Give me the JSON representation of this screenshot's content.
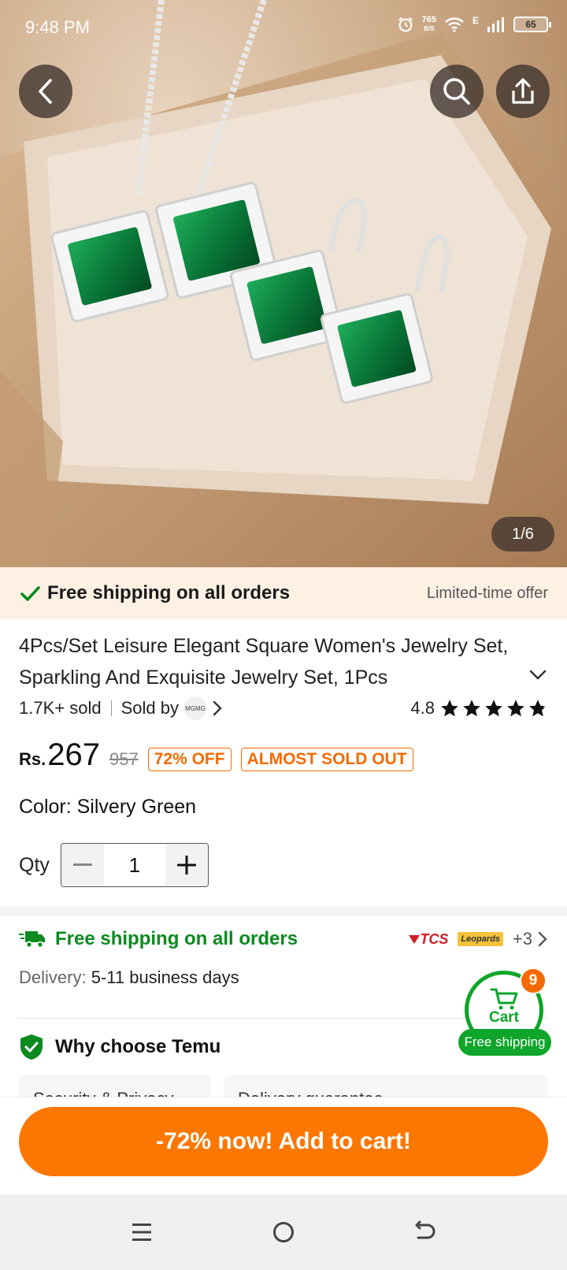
{
  "status_bar": {
    "time": "9:48 PM",
    "net_speed": "765",
    "net_unit": "B/S",
    "network_type": "E",
    "battery": "65"
  },
  "gallery": {
    "counter": "1/6"
  },
  "shipping_banner": {
    "title": "Free shipping on all orders",
    "offer": "Limited-time offer"
  },
  "product": {
    "title": "4Pcs/Set Leisure Elegant Square Women's Jewelry Set, Sparkling And Exquisite Jewelry Set, 1Pcs",
    "sold": "1.7K+ sold",
    "sold_by_label": "Sold by",
    "seller_logo_text": "MGMG",
    "rating": "4.8",
    "rating_stars": 4.8,
    "currency": "Rs.",
    "price": "267",
    "original_price": "957",
    "discount_badge": "72% OFF",
    "stock_badge": "ALMOST SOLD OUT",
    "color_label": "Color: Silvery Green",
    "qty_label": "Qty",
    "qty_value": "1"
  },
  "shipping_section": {
    "title": "Free shipping on all orders",
    "carrier_1": "TCS",
    "carrier_2": "Leopards",
    "more_carriers": "+3",
    "delivery_label": "Delivery:",
    "delivery_value": "5-11 business days"
  },
  "why_choose": {
    "title": "Why choose Temu",
    "card_1": "Security & Privacy",
    "card_2": "Delivery guarantee"
  },
  "cart": {
    "label": "Cart",
    "count": "9",
    "pill": "Free shipping"
  },
  "cta": {
    "label": "-72% now! Add to cart!"
  },
  "colors": {
    "accent_orange": "#fb7701",
    "green": "#0ea52a",
    "banner_bg": "#fdf1e4"
  }
}
